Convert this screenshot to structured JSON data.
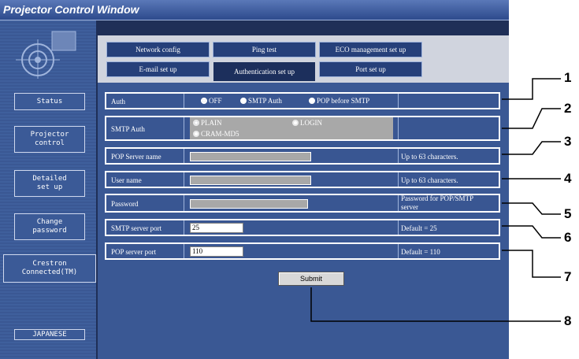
{
  "window": {
    "title": "Projector Control Window"
  },
  "sidebar": {
    "items": [
      {
        "label": "Status"
      },
      {
        "label": "Projector control"
      },
      {
        "label": "Detailed set up"
      },
      {
        "label": "Change password"
      },
      {
        "label": "Crestron Connected(TM)"
      }
    ],
    "language_button": "JAPANESE"
  },
  "tabs": {
    "row1": [
      "Network config",
      "Ping test",
      "ECO management set up"
    ],
    "row2": [
      "E-mail set up",
      "Authentication set up",
      "Port set up"
    ],
    "active": "Authentication set up"
  },
  "form": {
    "auth": {
      "label": "Auth",
      "options": [
        "OFF",
        "SMTP Auth",
        "POP before SMTP"
      ],
      "selected": "OFF"
    },
    "smtp_auth": {
      "label": "SMTP Auth",
      "options": [
        "PLAIN",
        "LOGIN",
        "CRAM-MD5"
      ],
      "selected": "PLAIN"
    },
    "pop_server_name": {
      "label": "POP Server name",
      "value": "",
      "hint": "Up to 63 characters."
    },
    "user_name": {
      "label": "User name",
      "value": "",
      "hint": "Up to 63 characters."
    },
    "password": {
      "label": "Password",
      "value": "",
      "hint_line1": "Password for POP/SMTP",
      "hint_line2": "server"
    },
    "smtp_server_port": {
      "label": "SMTP server port",
      "value": "25",
      "hint": "Default = 25"
    },
    "pop_server_port": {
      "label": "POP server port",
      "value": "110",
      "hint": "Default = 110"
    },
    "submit_label": "Submit"
  },
  "callouts": [
    "1",
    "2",
    "3",
    "4",
    "5",
    "6",
    "7",
    "8"
  ]
}
